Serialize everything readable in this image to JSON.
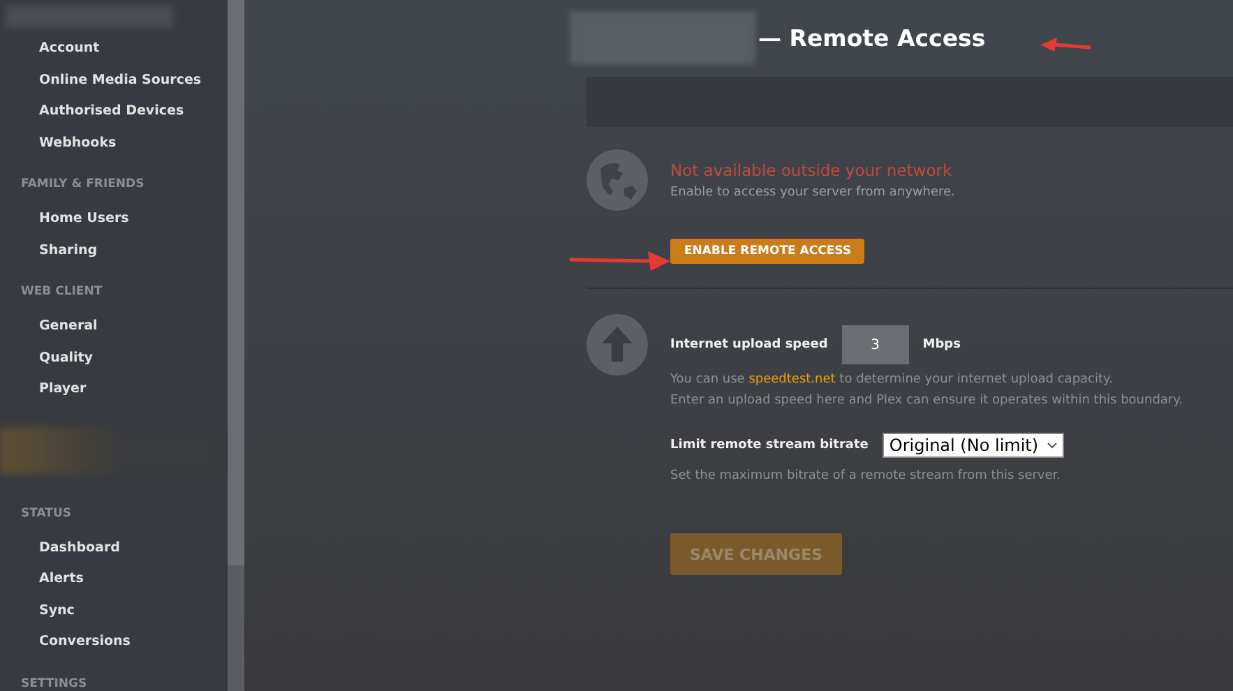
{
  "sidebar": {
    "sections": [
      {
        "items": [
          "Account",
          "Online Media Sources",
          "Authorised Devices",
          "Webhooks"
        ]
      },
      {
        "heading": "FAMILY & FRIENDS",
        "items": [
          "Home Users",
          "Sharing"
        ]
      },
      {
        "heading": "WEB CLIENT",
        "items": [
          "General",
          "Quality",
          "Player"
        ]
      },
      {
        "heading": "STATUS",
        "items": [
          "Dashboard",
          "Alerts",
          "Sync",
          "Conversions"
        ],
        "blurred_above": true
      },
      {
        "heading": "SETTINGS"
      }
    ]
  },
  "page": {
    "title": "— Remote Access",
    "status": {
      "message": "Not available outside your network",
      "detail": "Enable to access your server from anywhere.",
      "button": "ENABLE REMOTE ACCESS"
    },
    "upload": {
      "label": "Internet upload speed",
      "value": "3",
      "unit": "Mbps",
      "help_before": "You can use ",
      "help_link": "speedtest.net",
      "help_after": " to determine your internet upload capacity.",
      "help_2": "Enter an upload speed here and Plex can ensure it operates within this boundary."
    },
    "bitrate": {
      "label": "Limit remote stream bitrate",
      "value": "Original (No limit)",
      "help": "Set the maximum bitrate of a remote stream from this server."
    },
    "save": {
      "label": "SAVE CHANGES",
      "disabled": true
    }
  }
}
